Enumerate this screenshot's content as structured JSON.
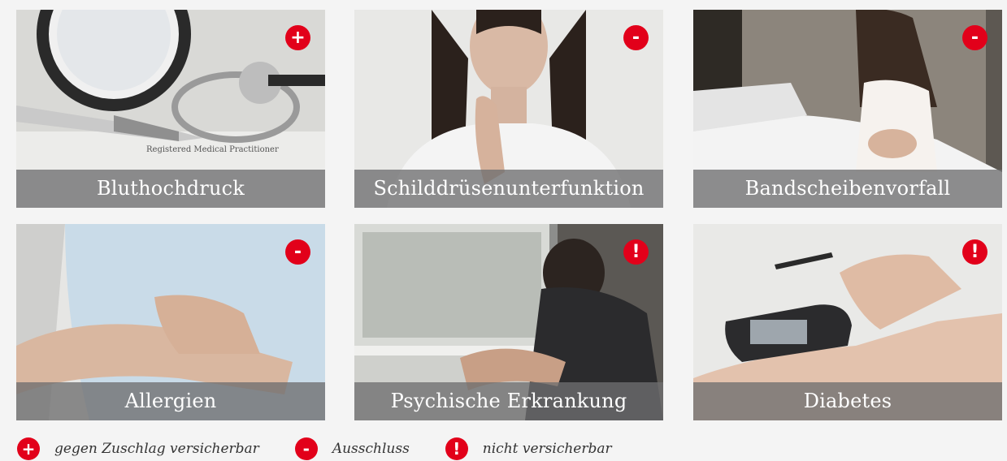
{
  "colors": {
    "accent": "#e2001a",
    "caption_bg": "#6e6e70"
  },
  "cards": [
    {
      "title": "Bluthochdruck",
      "badge": "+",
      "icon": "plus-icon"
    },
    {
      "title": "Schilddrüsenunterfunktion",
      "badge": "-",
      "icon": "minus-icon"
    },
    {
      "title": "Bandscheibenvorfall",
      "badge": "-",
      "icon": "minus-icon"
    },
    {
      "title": "Allergien",
      "badge": "-",
      "icon": "minus-icon"
    },
    {
      "title": "Psychische Erkrankung",
      "badge": "!",
      "icon": "exclamation-icon"
    },
    {
      "title": "Diabetes",
      "badge": "!",
      "icon": "exclamation-icon"
    }
  ],
  "legend": [
    {
      "symbol": "+",
      "label": "gegen Zuschlag versicherbar"
    },
    {
      "symbol": "-",
      "label": "Ausschluss"
    },
    {
      "symbol": "!",
      "label": "nicht versicherbar"
    }
  ]
}
